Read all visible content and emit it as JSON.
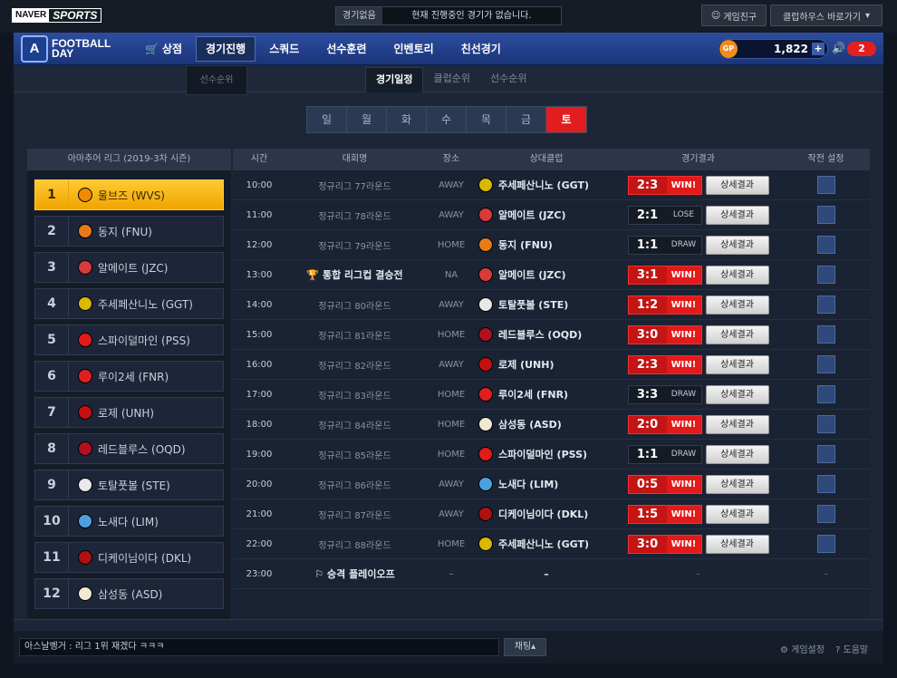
{
  "top": {
    "naver": "NAVER",
    "sports": "SPORTS",
    "status_tag": "경기없음",
    "status_msg": "현재 진행중인 경기가 없습니다.",
    "friend_btn": "게임친구",
    "clubhouse_btn": "클럽하우스 바로가기"
  },
  "nav": {
    "logo_badge": "A",
    "logo_line1": "FOOTBALL",
    "logo_line2": "DAY",
    "items": [
      {
        "label": "상점",
        "icon": "cart-icon"
      },
      {
        "label": "경기진행"
      },
      {
        "label": "스쿼드"
      },
      {
        "label": "선수훈련"
      },
      {
        "label": "인벤토리"
      },
      {
        "label": "친선경기"
      }
    ],
    "gp_label": "GP",
    "gp_value": "1,822",
    "gp_plus": "+",
    "alert_count": "2"
  },
  "submenu": {
    "label": "선수순위"
  },
  "subnav": {
    "tabs": [
      {
        "label": "경기일정"
      },
      {
        "label": "클럽순위"
      },
      {
        "label": "선수순위"
      }
    ]
  },
  "days": [
    "일",
    "월",
    "화",
    "수",
    "목",
    "금",
    "토"
  ],
  "league": {
    "title": "아마추어 리그 (2019-3차 시즌)",
    "ranks": [
      {
        "rank": "1",
        "club": "울브즈 (WVS)",
        "color": "#f28a00"
      },
      {
        "rank": "2",
        "club": "동지 (FNU)",
        "color": "#e87a1a"
      },
      {
        "rank": "3",
        "club": "알메이트 (JZC)",
        "color": "#d93a3a"
      },
      {
        "rank": "4",
        "club": "주세페산니노 (GGT)",
        "color": "#d9b800"
      },
      {
        "rank": "5",
        "club": "스파이덜마인 (PSS)",
        "color": "#e31a1a"
      },
      {
        "rank": "6",
        "club": "루이2세 (FNR)",
        "color": "#e02020"
      },
      {
        "rank": "7",
        "club": "로제 (UNH)",
        "color": "#c41010"
      },
      {
        "rank": "8",
        "club": "레드블루스 (OQD)",
        "color": "#b01020"
      },
      {
        "rank": "9",
        "club": "토탈풋볼 (STE)",
        "color": "#e8e8e8"
      },
      {
        "rank": "10",
        "club": "노새다 (LIM)",
        "color": "#4da0e0"
      },
      {
        "rank": "11",
        "club": "디케이님이다 (DKL)",
        "color": "#b01010"
      },
      {
        "rank": "12",
        "club": "삼성동 (ASD)",
        "color": "#f0e8d0"
      }
    ]
  },
  "schedule": {
    "headers": {
      "time": "시간",
      "comp": "대회명",
      "venue": "장소",
      "opp": "상대클럽",
      "result": "경기결과",
      "tactic": "작전 설정"
    },
    "detail_label": "상세결과",
    "rows": [
      {
        "time": "10:00",
        "comp": "정규리그 77라운드",
        "venue": "AWAY",
        "opp": "주세페산니노 (GGT)",
        "color": "#d9b800",
        "score": "2:3",
        "tag": "WIN!",
        "win": true
      },
      {
        "time": "11:00",
        "comp": "정규리그 78라운드",
        "venue": "AWAY",
        "opp": "알메이트 (JZC)",
        "color": "#d93a3a",
        "score": "2:1",
        "tag": "LOSE",
        "win": false
      },
      {
        "time": "12:00",
        "comp": "정규리그 79라운드",
        "venue": "HOME",
        "opp": "동지 (FNU)",
        "color": "#e87a1a",
        "score": "1:1",
        "tag": "DRAW",
        "win": false
      },
      {
        "time": "13:00",
        "comp": "통합 리그컵 결승전",
        "venue": "NA",
        "opp": "알메이트 (JZC)",
        "color": "#d93a3a",
        "score": "3:1",
        "tag": "WIN!",
        "win": true,
        "special": true,
        "comp_icon": "trophy-icon"
      },
      {
        "time": "14:00",
        "comp": "정규리그 80라운드",
        "venue": "AWAY",
        "opp": "토탈풋볼 (STE)",
        "color": "#e8e8e8",
        "score": "1:2",
        "tag": "WIN!",
        "win": true
      },
      {
        "time": "15:00",
        "comp": "정규리그 81라운드",
        "venue": "HOME",
        "opp": "레드블루스 (OQD)",
        "color": "#b01020",
        "score": "3:0",
        "tag": "WIN!",
        "win": true
      },
      {
        "time": "16:00",
        "comp": "정규리그 82라운드",
        "venue": "AWAY",
        "opp": "로제 (UNH)",
        "color": "#c41010",
        "score": "2:3",
        "tag": "WIN!",
        "win": true
      },
      {
        "time": "17:00",
        "comp": "정규리그 83라운드",
        "venue": "HOME",
        "opp": "루이2세 (FNR)",
        "color": "#e02020",
        "score": "3:3",
        "tag": "DRAW",
        "win": false
      },
      {
        "time": "18:00",
        "comp": "정규리그 84라운드",
        "venue": "HOME",
        "opp": "삼성동 (ASD)",
        "color": "#f0e8d0",
        "score": "2:0",
        "tag": "WIN!",
        "win": true
      },
      {
        "time": "19:00",
        "comp": "정규리그 85라운드",
        "venue": "HOME",
        "opp": "스파이덜마인 (PSS)",
        "color": "#e31a1a",
        "score": "1:1",
        "tag": "DRAW",
        "win": false
      },
      {
        "time": "20:00",
        "comp": "정규리그 86라운드",
        "venue": "AWAY",
        "opp": "노새다 (LIM)",
        "color": "#4da0e0",
        "score": "0:5",
        "tag": "WIN!",
        "win": true
      },
      {
        "time": "21:00",
        "comp": "정규리그 87라운드",
        "venue": "AWAY",
        "opp": "디케이님이다 (DKL)",
        "color": "#b01010",
        "score": "1:5",
        "tag": "WIN!",
        "win": true
      },
      {
        "time": "22:00",
        "comp": "정규리그 88라운드",
        "venue": "HOME",
        "opp": "주세페산니노 (GGT)",
        "color": "#d9b800",
        "score": "3:0",
        "tag": "WIN!",
        "win": true
      }
    ],
    "last_row": {
      "time": "23:00",
      "comp": "승격 플레이오프",
      "comp_icon": "flag-icon",
      "dash": "–"
    }
  },
  "chat": {
    "message": "아스날벵거 : 리그 1위 재겠다 ㅋㅋㅋ",
    "button": "채팅▴",
    "settings": "게임설정",
    "help": "도움말"
  }
}
